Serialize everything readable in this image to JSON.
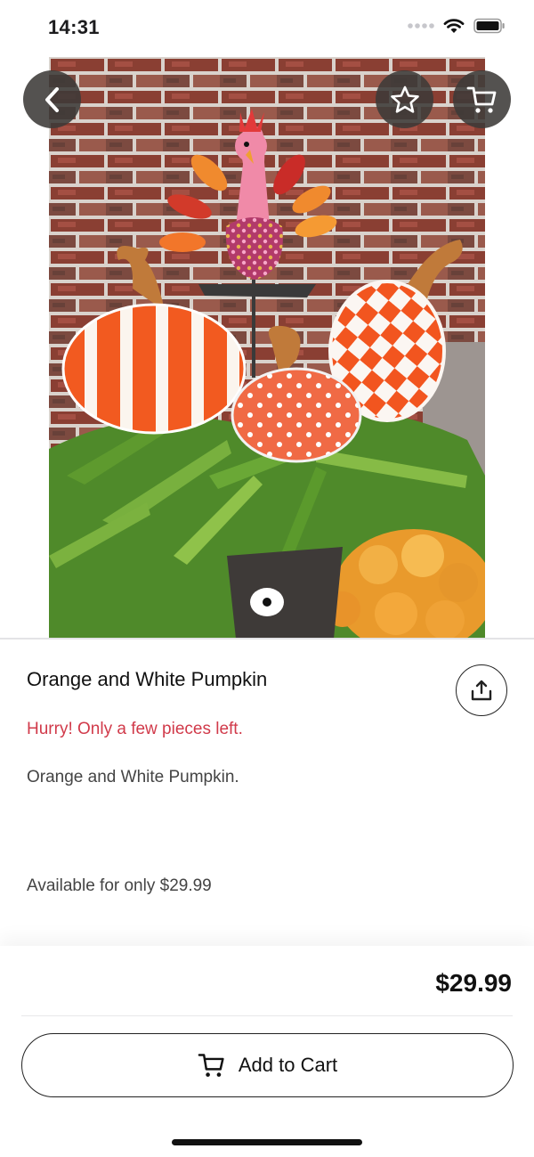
{
  "status_bar": {
    "time": "14:31"
  },
  "nav": {
    "back_icon": "chevron-left-icon",
    "favorite_icon": "star-outline-icon",
    "cart_icon": "cart-icon"
  },
  "gallery": {
    "page_count": 1,
    "current_page": 1
  },
  "product": {
    "title": "Orange and White Pumpkin",
    "stock_warning": "Hurry! Only a few pieces left.",
    "description": "Orange and White Pumpkin.",
    "availability": "Available for only $29.99"
  },
  "share_icon": "share-icon",
  "checkout": {
    "price": "$29.99",
    "add_to_cart_label": "Add to Cart"
  },
  "colors": {
    "warning": "#d13a4a",
    "overlay_button": "#3c3a38",
    "text": "#111111"
  }
}
